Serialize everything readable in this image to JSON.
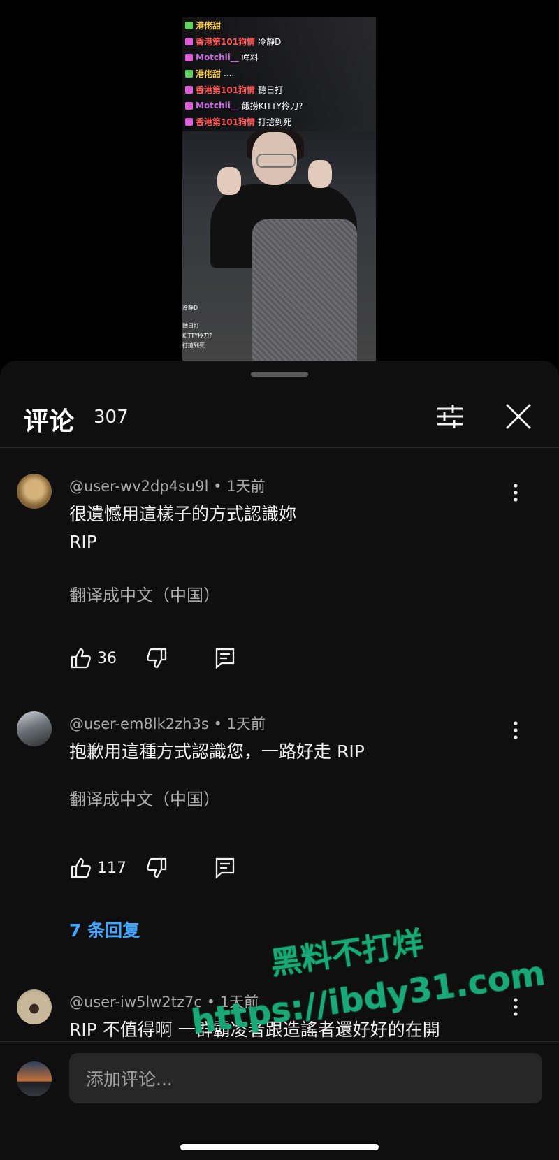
{
  "video": {
    "chat": [
      {
        "name": "港佬甜",
        "name_color": "#f2c94c",
        "message": "",
        "badge_color": "#5fd35f"
      },
      {
        "name": "香港第101狗情",
        "name_color": "#ff5a5a",
        "message": "冷靜D",
        "badge_color": "#e05cd8"
      },
      {
        "name": "Motchii__",
        "name_color": "#c86be0",
        "message": "咩料",
        "badge_color": "#e05cd8"
      },
      {
        "name": "港佬甜",
        "name_color": "#f2c94c",
        "message": "....",
        "badge_color": "#5fd35f"
      },
      {
        "name": "香港第101狗情",
        "name_color": "#ff5a5a",
        "message": "聽日打",
        "badge_color": "#e05cd8"
      },
      {
        "name": "Motchii__",
        "name_color": "#c86be0",
        "message": "餓捞KITTY拎刀?",
        "badge_color": "#e05cd8"
      },
      {
        "name": "香港第101狗情",
        "name_color": "#ff5a5a",
        "message": "打搶到死",
        "badge_color": "#e05cd8"
      }
    ],
    "overlay_lines": [
      "冷靜D",
      "聽日打",
      "KITTY拎刀?",
      "打搶到死"
    ]
  },
  "sheet": {
    "title": "评论",
    "count": "307",
    "filter_icon": "sliders-icon",
    "close_icon": "close-icon"
  },
  "comments": [
    {
      "author": "@user-wv2dp4su9l",
      "time": "1天前",
      "text": "很遺憾用這樣子的方式認識妳\nRIP",
      "translate": "翻译成中文（中国）",
      "likes": "36"
    },
    {
      "author": "@user-em8lk2zh3s",
      "time": "1天前",
      "text": "抱歉用這種方式認識您，一路好走 RIP",
      "translate": "翻译成中文（中国）",
      "likes": "117",
      "replies": "7 条回复"
    },
    {
      "author": "@user-iw5lw2tz7c",
      "time": "1天前",
      "text": "RIP 不值得啊 一群霸凌者跟造謠者還好好的在開"
    }
  ],
  "watermark": {
    "line1": "黑料不打烊",
    "line2": "https://ibdy31.com"
  },
  "composer": {
    "placeholder": "添加评论..."
  },
  "colors": {
    "background": "#0f0f0f",
    "link": "#3ea6ff",
    "watermark": "#1aa87a"
  }
}
